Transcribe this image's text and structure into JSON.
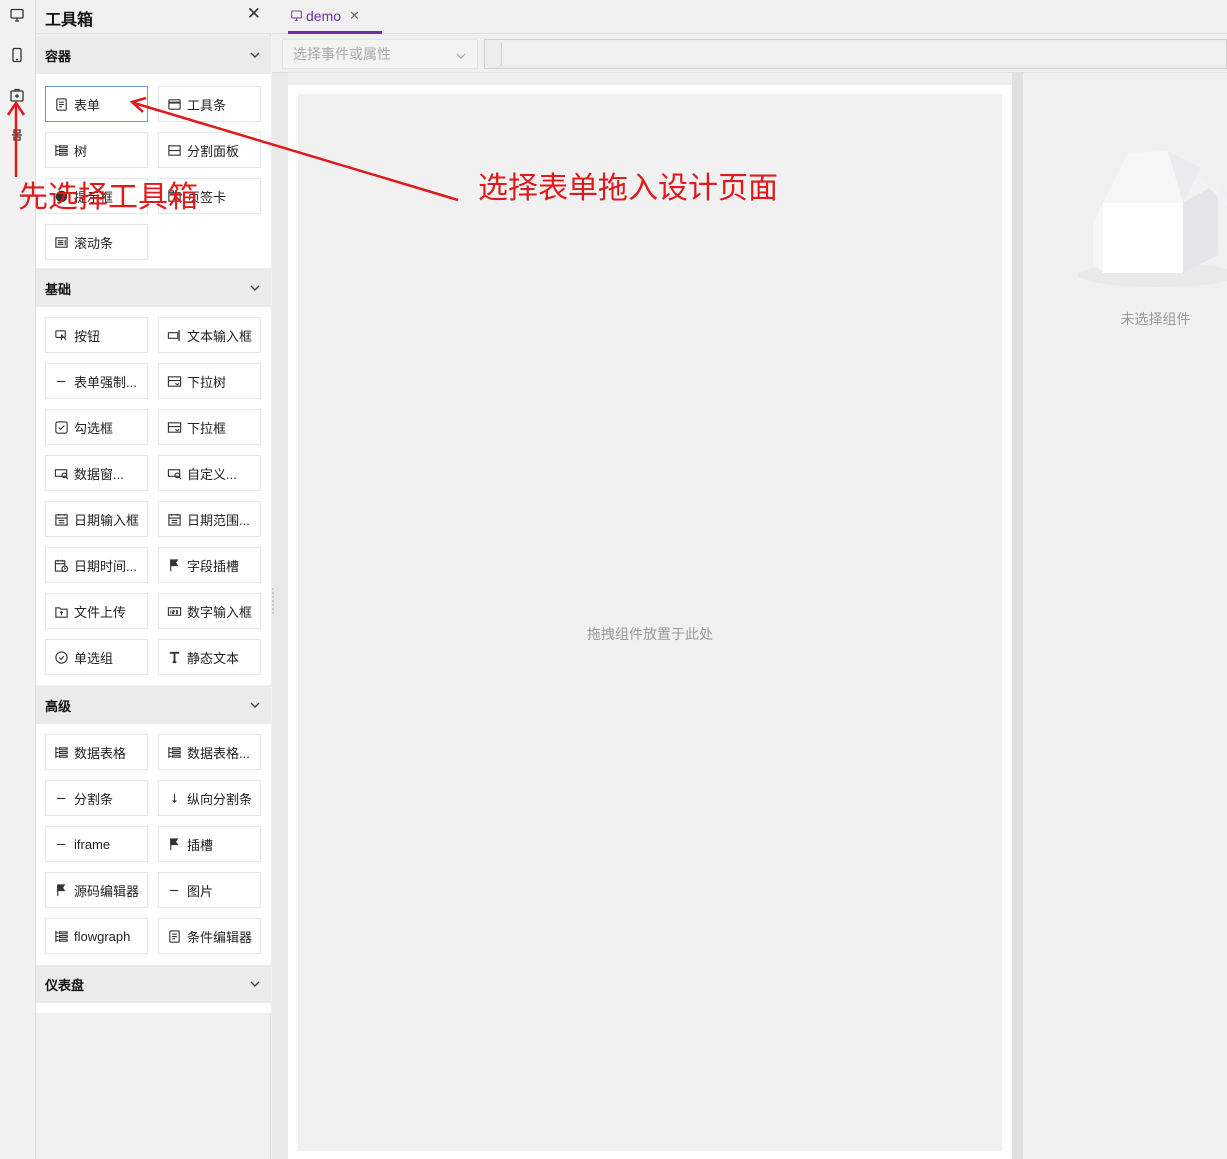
{
  "panel": {
    "title": "工具箱",
    "close": "✕"
  },
  "tab": {
    "label": "demo",
    "close": "✕"
  },
  "toolbar": {
    "event_select_placeholder": "选择事件或属性"
  },
  "canvas": {
    "hint": "拖拽组件放置于此处"
  },
  "right_panel": {
    "empty_label": "未选择组件"
  },
  "annotations": {
    "left": "先选择工具箱",
    "right": "选择表单拖入设计页面"
  },
  "sections": {
    "container": {
      "title": "容器",
      "items": [
        "表单",
        "工具条",
        "树",
        "分割面板",
        "提示框",
        "页签卡",
        "滚动条"
      ]
    },
    "basic": {
      "title": "基础",
      "items": [
        "按钮",
        "文本输入框",
        "表单强制...",
        "下拉树",
        "勾选框",
        "下拉框",
        "数据窗...",
        "自定义...",
        "日期输入框",
        "日期范围...",
        "日期时间...",
        "字段插槽",
        "文件上传",
        "数字输入框",
        "单选组",
        "静态文本"
      ]
    },
    "advanced": {
      "title": "高级",
      "items": [
        "数据表格",
        "数据表格...",
        "分割条",
        "纵向分割条",
        "iframe",
        "插槽",
        "源码编辑器",
        "图片",
        "flowgraph",
        "条件编辑器"
      ]
    },
    "dashboard": {
      "title": "仪表盘"
    }
  }
}
